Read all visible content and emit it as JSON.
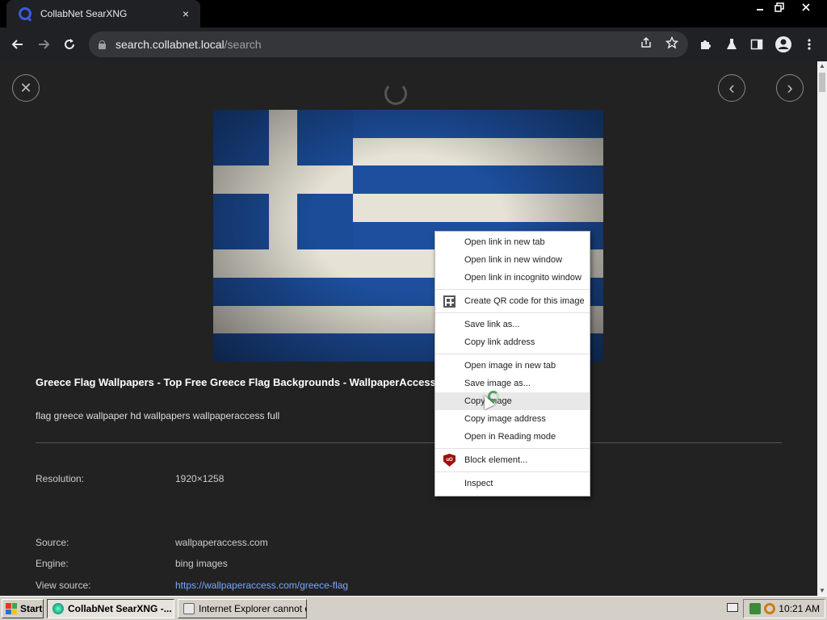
{
  "browser": {
    "tab_title": "CollabNet SearXNG",
    "tab_close": "×",
    "url_host": "search.collabnet.local",
    "url_path": "/search"
  },
  "viewer": {
    "close_glyph": "✕",
    "prev_glyph": "‹",
    "next_glyph": "›"
  },
  "result": {
    "title": "Greece Flag Wallpapers - Top Free Greece Flag Backgrounds - WallpaperAccess",
    "description": "flag greece wallpaper hd wallpapers wallpaperaccess full",
    "fields": [
      {
        "label": "Resolution:",
        "value": "1920×1258"
      },
      {
        "label": "Source:",
        "value": "wallpaperaccess.com"
      },
      {
        "label": "Engine:",
        "value": "bing images"
      },
      {
        "label": "View source:",
        "value": "https://wallpaperaccess.com/greece-flag"
      }
    ]
  },
  "context_menu": {
    "groups": [
      [
        "Open link in new tab",
        "Open link in new window",
        "Open link in incognito window"
      ],
      [
        "Create QR code for this image"
      ],
      [
        "Save link as...",
        "Copy link address"
      ],
      [
        "Open image in new tab",
        "Save image as...",
        "Copy image",
        "Copy image address",
        "Open in Reading mode"
      ],
      [
        "Block element..."
      ],
      [
        "Inspect"
      ]
    ],
    "highlighted": "Copy image",
    "ublock_badge": "uO"
  },
  "taskbar": {
    "start_label": "Start",
    "tasks": [
      "CollabNet SearXNG -...",
      "Internet Explorer cannot d..."
    ],
    "clock": "10:21 AM"
  }
}
